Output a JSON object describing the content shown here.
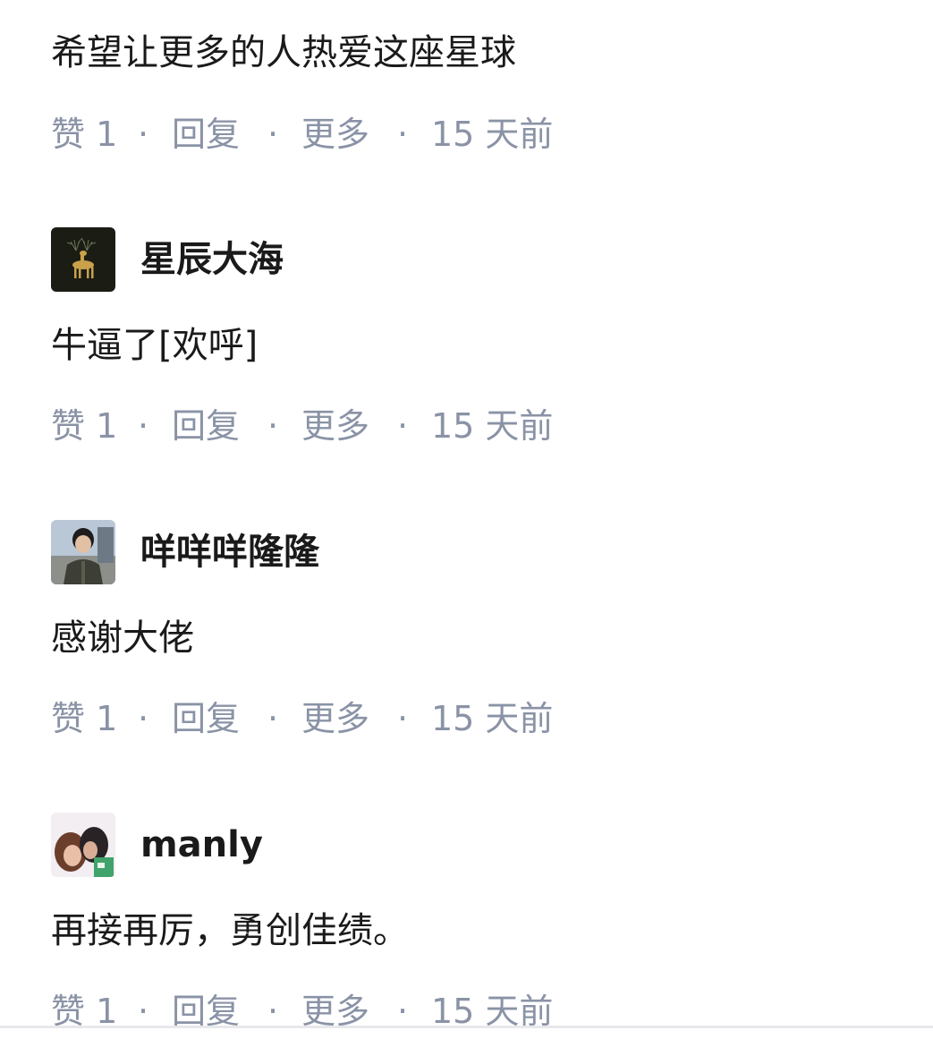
{
  "comments": [
    {
      "user": null,
      "text": "希望让更多的人热爱这座星球",
      "like_label": "赞",
      "like_count": "1",
      "reply_label": "回复",
      "more_label": "更多",
      "time": "15 天前"
    },
    {
      "user": "星辰大海",
      "avatar_icon": "golden-deer-avatar",
      "text": "牛逼了[欢呼]",
      "like_label": "赞",
      "like_count": "1",
      "reply_label": "回复",
      "more_label": "更多",
      "time": "15 天前"
    },
    {
      "user": "咩咩咩隆隆",
      "avatar_icon": "person-photo-avatar",
      "text": "感谢大佬",
      "like_label": "赞",
      "like_count": "1",
      "reply_label": "回复",
      "more_label": "更多",
      "time": "15 天前"
    },
    {
      "user": "manly",
      "avatar_icon": "couple-photo-avatar",
      "text": "再接再厉，勇创佳绩。",
      "like_label": "赞",
      "like_count": "1",
      "reply_label": "回复",
      "more_label": "更多",
      "time": "15 天前"
    }
  ],
  "separator": "·",
  "colors": {
    "text": "#1a1a1a",
    "meta": "#8a93a6",
    "background": "#ffffff"
  }
}
